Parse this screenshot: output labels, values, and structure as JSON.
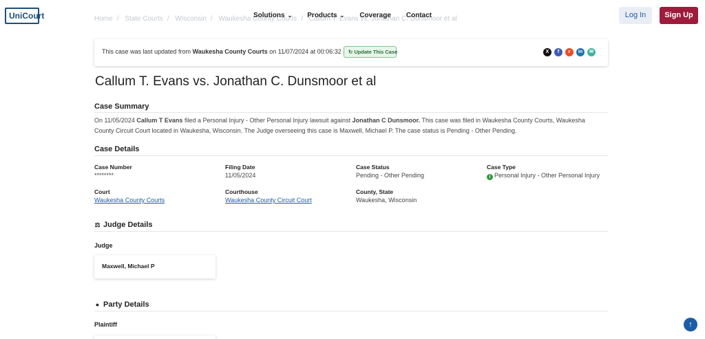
{
  "header": {
    "logo": "UniCourt",
    "breadcrumb": [
      "Home",
      "State Courts",
      "Wisconsin",
      "Waukesha County Courts",
      "Callum T. Evans vs. Jonathan C. Dunsmoor et al"
    ],
    "nav": [
      {
        "label": "Solutions",
        "has_dropdown": true
      },
      {
        "label": "Products",
        "has_dropdown": true
      },
      {
        "label": "Coverage",
        "has_dropdown": false
      },
      {
        "label": "Contact",
        "has_dropdown": false
      }
    ],
    "login_label": "Log In",
    "signup_label": "Sign Up"
  },
  "update_bar": {
    "prefix": "This case was last updated from",
    "source": "Waukesha County Courts",
    "suffix": "on 11/07/2024 at 00:06:32 (UTC).",
    "button_label": "Update This Case",
    "share_icons": [
      "x-icon",
      "facebook-icon",
      "reddit-icon",
      "linkedin-icon",
      "email-icon"
    ]
  },
  "case": {
    "title": "Callum T. Evans vs. Jonathan C. Dunsmoor et al"
  },
  "summary": {
    "heading": "Case Summary",
    "part1": "On 11/05/2024",
    "plaintiff": "Callum T Evans",
    "part2": "filed a Personal Injury - Other Personal Injury lawsuit against",
    "defendant": "Jonathan C Dunsmoor.",
    "part3": "This case was filed in Waukesha County Courts, Waukesha County Circuit Court located in Waukesha, Wisconsin. The Judge overseeing this case is Maxwell, Michael P. The case status is Pending - Other Pending."
  },
  "details": {
    "heading": "Case Details",
    "case_number_label": "Case Number",
    "case_number": "********",
    "filing_date_label": "Filing Date",
    "filing_date": "11/05/2024",
    "case_status_label": "Case Status",
    "case_status": "Pending - Other Pending",
    "case_type_label": "Case Type",
    "case_type": "Personal Injury - Other Personal Injury",
    "court_label": "Court",
    "court": "Waukesha County Courts",
    "courthouse_label": "Courthouse",
    "courthouse": "Waukesha County Circuit Court",
    "county_state_label": "County, State",
    "county_state": "Waukesha, Wisconsin"
  },
  "judge": {
    "heading": "Judge Details",
    "sub_label": "Judge",
    "name": "Maxwell, Michael P"
  },
  "party": {
    "heading": "Party Details",
    "sub_label": "Plaintiff"
  },
  "colors": {
    "primary_blue": "#1c5da8",
    "signup_red": "#9e1b3b",
    "update_green": "#2d6a3a"
  }
}
